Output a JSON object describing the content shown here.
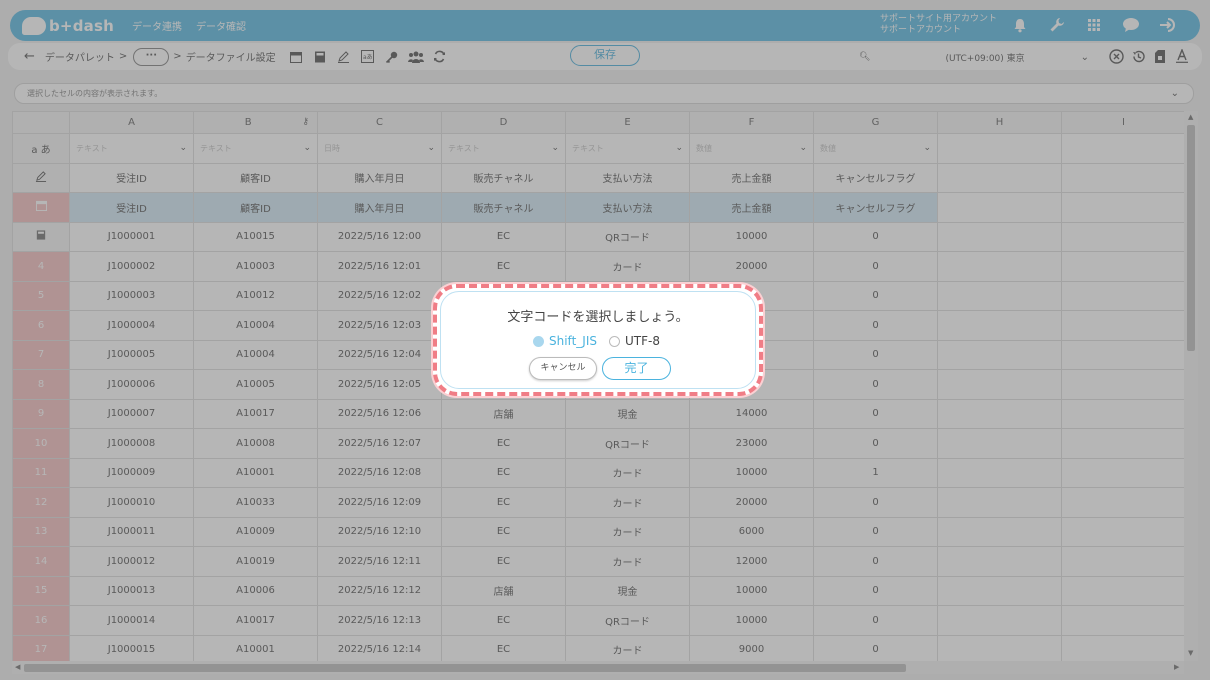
{
  "header": {
    "logo_text": "b+dash",
    "nav": [
      "データ連携",
      "データ確認"
    ],
    "account_line1": "サポートサイト用アカウント",
    "account_line2": "サポートアカウント",
    "accent": "#4bb3de"
  },
  "toolbar": {
    "breadcrumb_root": "データパレット",
    "breadcrumb_more": "···",
    "breadcrumb_current": "データファイル設定",
    "save_label": "保存",
    "timezone": "(UTC+09:00) 東京"
  },
  "cellbar": {
    "placeholder": "選択したセルの内容が表示されます。"
  },
  "grid": {
    "col_letters": [
      "A",
      "B",
      "C",
      "D",
      "E",
      "F",
      "G",
      "H",
      "I"
    ],
    "type_row_label": "a あ",
    "types": [
      "テキスト",
      "テキスト",
      "日時",
      "テキスト",
      "テキスト",
      "数値",
      "数値"
    ],
    "header_row": [
      "受注ID",
      "顧客ID",
      "購入年月日",
      "販売チャネル",
      "支払い方法",
      "売上金額",
      "キャンセルフラグ"
    ],
    "header_row2": [
      "受注ID",
      "顧客ID",
      "購入年月日",
      "販売チャネル",
      "支払い方法",
      "売上金額",
      "キャンセルフラグ"
    ],
    "rows": [
      {
        "n": "",
        "cells": [
          "J1000001",
          "A10015",
          "2022/5/16 12:00",
          "EC",
          "QRコード",
          "10000",
          "0"
        ]
      },
      {
        "n": "4",
        "cells": [
          "J1000002",
          "A10003",
          "2022/5/16 12:01",
          "EC",
          "カード",
          "20000",
          "0"
        ]
      },
      {
        "n": "5",
        "cells": [
          "J1000003",
          "A10012",
          "2022/5/16 12:02",
          "",
          "",
          "",
          "0"
        ]
      },
      {
        "n": "6",
        "cells": [
          "J1000004",
          "A10004",
          "2022/5/16 12:03",
          "",
          "",
          "",
          "0"
        ]
      },
      {
        "n": "7",
        "cells": [
          "J1000005",
          "A10004",
          "2022/5/16 12:04",
          "",
          "",
          "",
          "0"
        ]
      },
      {
        "n": "8",
        "cells": [
          "J1000006",
          "A10005",
          "2022/5/16 12:05",
          "",
          "",
          "0",
          "0"
        ]
      },
      {
        "n": "9",
        "cells": [
          "J1000007",
          "A10017",
          "2022/5/16 12:06",
          "店舗",
          "現金",
          "14000",
          "0"
        ]
      },
      {
        "n": "10",
        "cells": [
          "J1000008",
          "A10008",
          "2022/5/16 12:07",
          "EC",
          "QRコード",
          "23000",
          "0"
        ]
      },
      {
        "n": "11",
        "cells": [
          "J1000009",
          "A10001",
          "2022/5/16 12:08",
          "EC",
          "カード",
          "10000",
          "1"
        ]
      },
      {
        "n": "12",
        "cells": [
          "J1000010",
          "A10033",
          "2022/5/16 12:09",
          "EC",
          "カード",
          "20000",
          "0"
        ]
      },
      {
        "n": "13",
        "cells": [
          "J1000011",
          "A10009",
          "2022/5/16 12:10",
          "EC",
          "カード",
          "6000",
          "0"
        ]
      },
      {
        "n": "14",
        "cells": [
          "J1000012",
          "A10019",
          "2022/5/16 12:11",
          "EC",
          "カード",
          "12000",
          "0"
        ]
      },
      {
        "n": "15",
        "cells": [
          "J1000013",
          "A10006",
          "2022/5/16 12:12",
          "店舗",
          "現金",
          "10000",
          "0"
        ]
      },
      {
        "n": "16",
        "cells": [
          "J1000014",
          "A10017",
          "2022/5/16 12:13",
          "EC",
          "QRコード",
          "10000",
          "0"
        ]
      },
      {
        "n": "17",
        "cells": [
          "J1000015",
          "A10001",
          "2022/5/16 12:14",
          "EC",
          "カード",
          "9000",
          "0"
        ]
      }
    ]
  },
  "dialog": {
    "title": "文字コードを選択しましょう。",
    "options": [
      "Shift_JIS",
      "UTF-8"
    ],
    "selected": "Shift_JIS",
    "cancel_label": "キャンセル",
    "ok_label": "完了"
  }
}
